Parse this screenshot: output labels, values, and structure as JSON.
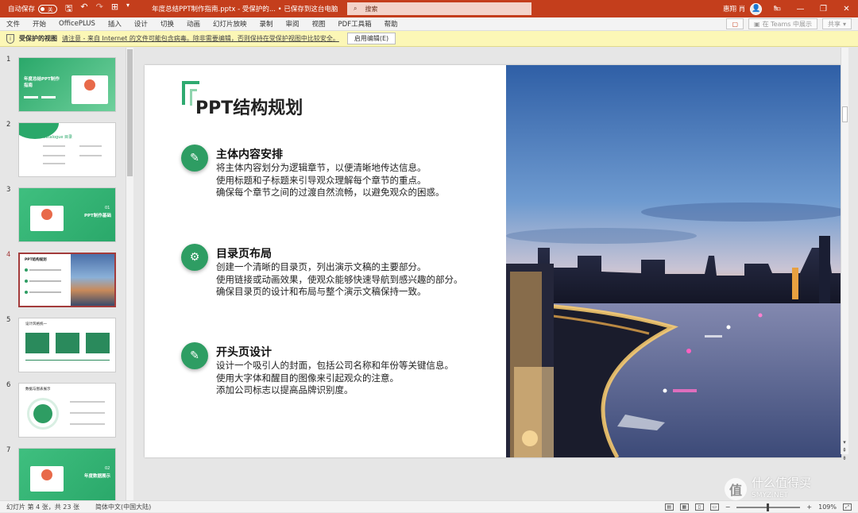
{
  "titlebar": {
    "autosave_label": "自动保存",
    "autosave_state": "关",
    "doc_title": "年度总结PPT制作指南.pptx  -  受保护的...   •  已保存到这台电脑",
    "search_placeholder": "搜索",
    "user_name": "惠翔 肖",
    "accent": "#c43e1c"
  },
  "menu": {
    "items": [
      "文件",
      "开始",
      "OfficePLUS",
      "插入",
      "设计",
      "切换",
      "动画",
      "幻灯片放映",
      "录制",
      "审阅",
      "视图",
      "PDF工具箱",
      "帮助"
    ],
    "teams_label": "在 Teams 中展示",
    "share_label": "共享"
  },
  "protected": {
    "title": "受保护的视图",
    "message": "请注意 - 来自 Internet 的文件可能包含病毒。除非需要编辑，否则保持在受保护视图中比较安全。",
    "button": "启用编辑(E)"
  },
  "thumbnails": [
    {
      "num": "1",
      "title": "年度总结PPT制作指南"
    },
    {
      "num": "2",
      "title": "Catalogue 目录"
    },
    {
      "num": "3",
      "title": "PPT制作基础",
      "sub": "01"
    },
    {
      "num": "4",
      "title": "PPT结构规划"
    },
    {
      "num": "5",
      "title": "设计风格统一"
    },
    {
      "num": "6",
      "title": "数据与图表展示"
    },
    {
      "num": "7",
      "title": "年度数据展示",
      "sub": "02"
    }
  ],
  "slide": {
    "title": "PPT结构规划",
    "sections": [
      {
        "heading": "主体内容安排",
        "lines": [
          "将主体内容划分为逻辑章节，以便清晰地传达信息。",
          "使用标题和子标题来引导观众理解每个章节的重点。",
          "确保每个章节之间的过渡自然流畅，以避免观众的困惑。"
        ],
        "icon": "leaf-icon"
      },
      {
        "heading": "目录页布局",
        "lines": [
          "创建一个清晰的目录页，列出演示文稿的主要部分。",
          "使用链接或动画效果，使观众能够快速导航到感兴趣的部分。",
          "确保目录页的设计和布局与整个演示文稿保持一致。"
        ],
        "icon": "gear-icon"
      },
      {
        "heading": "开头页设计",
        "lines": [
          "设计一个吸引人的封面，包括公司名称和年份等关键信息。",
          "使用大字体和醒目的图像来引起观众的注意。",
          "添加公司标志以提高品牌识别度。"
        ],
        "icon": "leaf-icon"
      }
    ],
    "accent": "#2e9d63"
  },
  "status": {
    "slide_info": "幻灯片 第 4 张，共 23 张",
    "language": "简体中文(中国大陆)",
    "zoom": "109%"
  },
  "watermark": {
    "brand": "什么值得买",
    "site": "SMYZ.NET"
  }
}
